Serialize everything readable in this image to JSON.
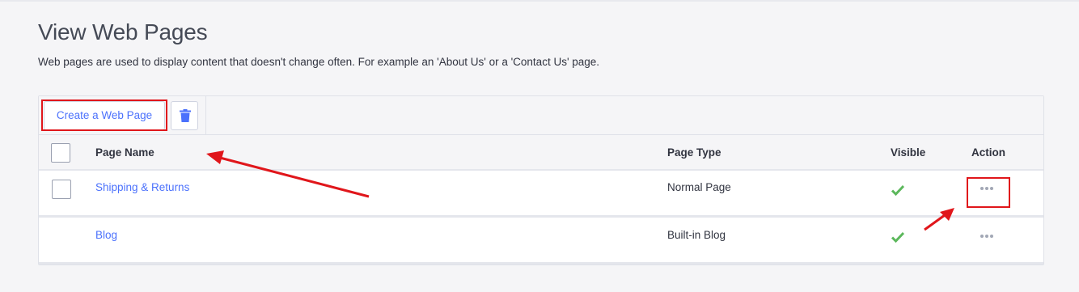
{
  "header": {
    "title": "View Web Pages",
    "description": "Web pages are used to display content that doesn't change often. For example an 'About Us' or a 'Contact Us' page."
  },
  "toolbar": {
    "create_label": "Create a Web Page",
    "delete_icon": "trash-icon"
  },
  "table": {
    "columns": [
      "Page Name",
      "Page Type",
      "Visible",
      "Action"
    ],
    "rows": [
      {
        "name": "Shipping & Returns",
        "type": "Normal Page",
        "visible": true,
        "action_icon": "more-options-icon",
        "has_checkbox": true
      },
      {
        "name": "Blog",
        "type": "Built-in Blog",
        "visible": true,
        "action_icon": "more-options-icon",
        "has_checkbox": false
      }
    ]
  },
  "colors": {
    "accent": "#4b71fc",
    "annotation": "#e0161b",
    "check": "#5cb85c"
  }
}
